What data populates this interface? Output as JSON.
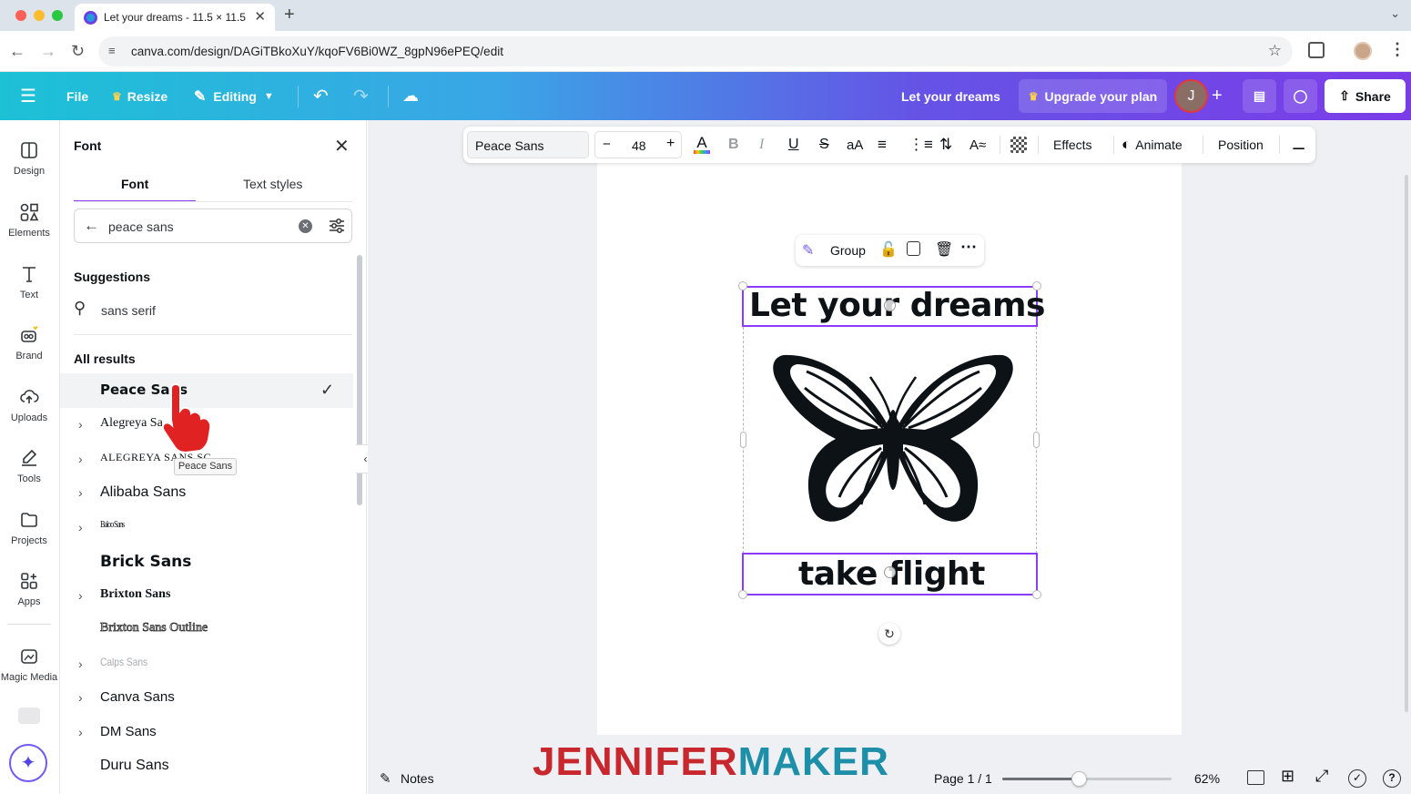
{
  "browser": {
    "tab_title": "Let your dreams - 11.5 × 11.5",
    "tab_close": "✕",
    "new_tab": "+",
    "url": "canva.com/design/DAGiTBkoXuY/kqoFV6Bi0WZ_8gpN96ePEQ/edit"
  },
  "header": {
    "file_label": "File",
    "resize_label": "Resize",
    "editing_label": "Editing",
    "design_title": "Let your dreams",
    "upgrade_label": "Upgrade your plan",
    "avatar_initial": "J",
    "share_label": "Share",
    "accent": "#7b3ce8"
  },
  "rail": {
    "items": [
      {
        "label": "Design"
      },
      {
        "label": "Elements"
      },
      {
        "label": "Text"
      },
      {
        "label": "Brand"
      },
      {
        "label": "Uploads"
      },
      {
        "label": "Tools"
      },
      {
        "label": "Projects"
      },
      {
        "label": "Apps"
      },
      {
        "label": "Magic Media"
      }
    ]
  },
  "panel": {
    "title": "Font",
    "tabs": [
      "Font",
      "Text styles"
    ],
    "search_value": "peace sans",
    "suggestions_heading": "Suggestions",
    "suggestion": "sans serif",
    "results_heading": "All results",
    "results": [
      {
        "name": "Peace Sans",
        "selected": true,
        "expandable": false
      },
      {
        "name": "Alegreya Sa",
        "selected": false,
        "expandable": true
      },
      {
        "name": "ALEGREYA SANS SC",
        "selected": false,
        "expandable": true
      },
      {
        "name": "Alibaba Sans",
        "selected": false,
        "expandable": true
      },
      {
        "name": "Baloo Sans",
        "selected": false,
        "expandable": true
      },
      {
        "name": "Brick Sans",
        "selected": false,
        "expandable": false
      },
      {
        "name": "Brixton Sans",
        "selected": false,
        "expandable": true
      },
      {
        "name": "Brixton Sans Outline",
        "selected": false,
        "expandable": false
      },
      {
        "name": "Calps Sans",
        "selected": false,
        "expandable": true
      },
      {
        "name": "Canva Sans",
        "selected": false,
        "expandable": true
      },
      {
        "name": "DM Sans",
        "selected": false,
        "expandable": true
      },
      {
        "name": "Duru Sans",
        "selected": false,
        "expandable": false
      }
    ],
    "tooltip": "Peace Sans"
  },
  "toolbar": {
    "font_name": "Peace Sans",
    "minus": "−",
    "font_size": "48",
    "plus": "+",
    "case_label": "aA",
    "effects_label": "Effects",
    "animate_label": "Animate",
    "position_label": "Position"
  },
  "group_bar": {
    "group_label": "Group"
  },
  "canvas": {
    "line1": "Let your dreams",
    "line2": "take flight"
  },
  "footer": {
    "notes_label": "Notes",
    "page_label": "Page 1 / 1",
    "zoom_label": "62%",
    "zoom_fraction": 0.45
  },
  "watermark": {
    "part1": "JENNIFER",
    "part2": "MAKER",
    "color1": "#c8282d",
    "color2": "#1e8fa8"
  }
}
